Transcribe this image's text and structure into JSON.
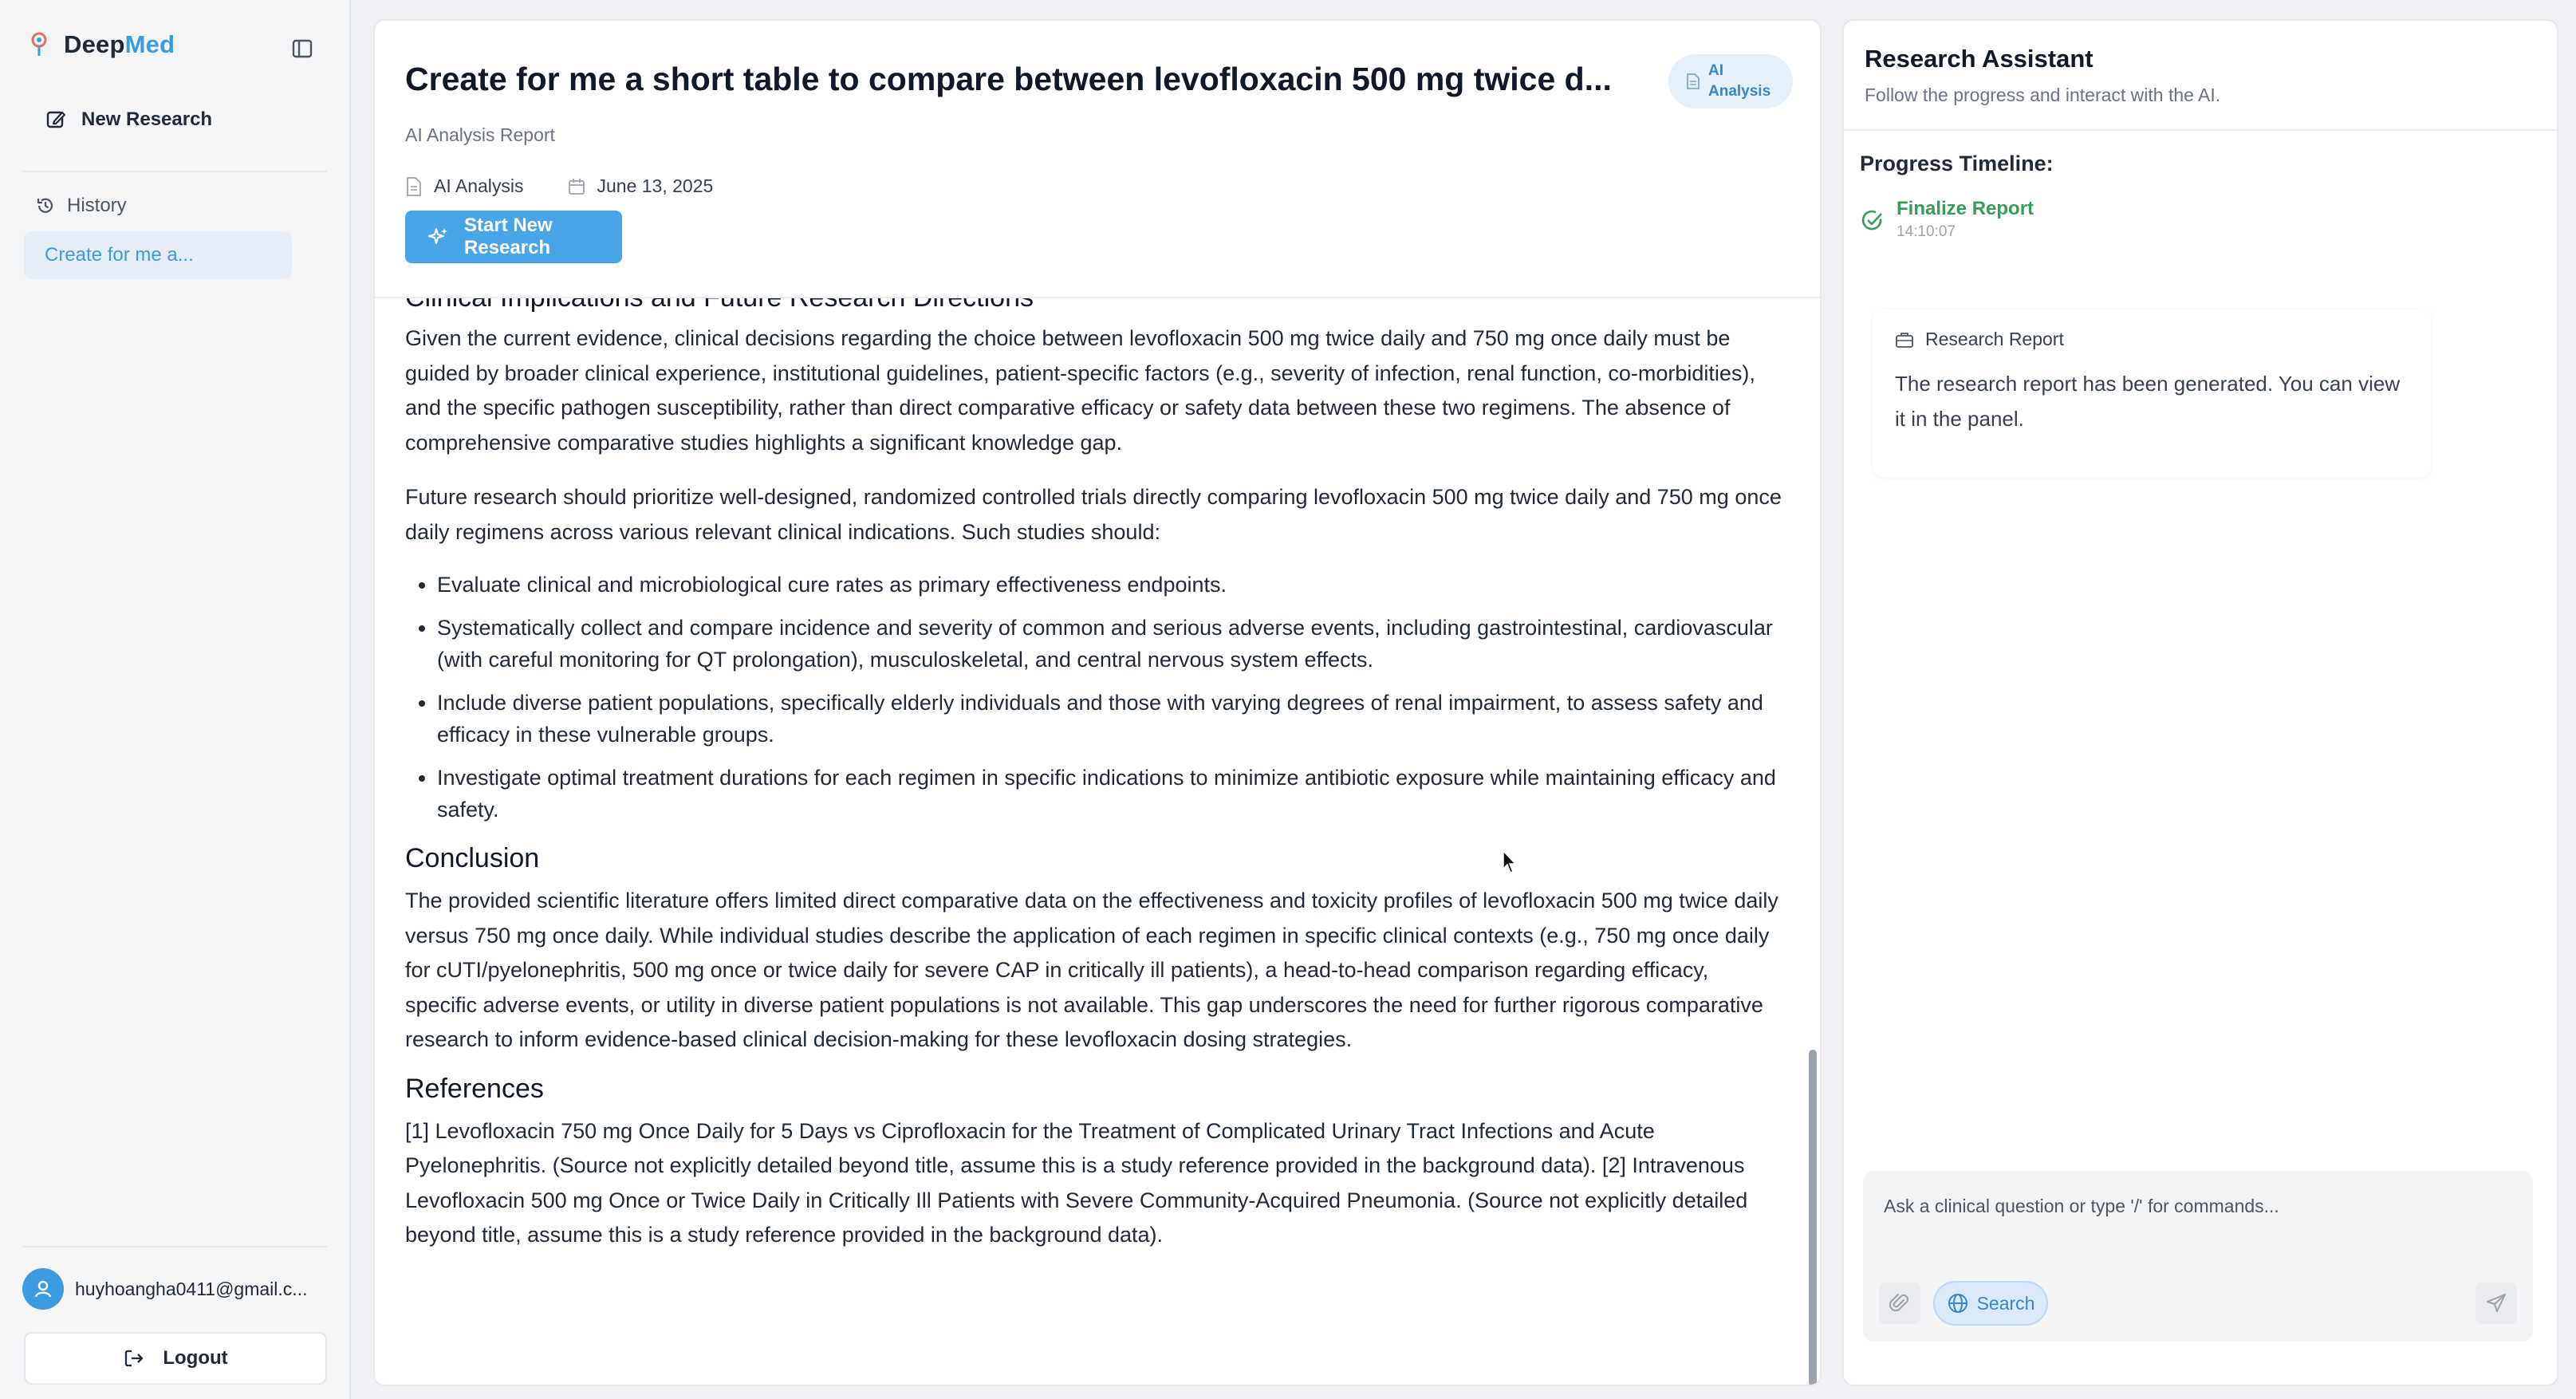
{
  "colors": {
    "accent": "#3b9be0",
    "button_blue": "#49a5e6",
    "success_green": "#3a9a57"
  },
  "sidebar": {
    "brand": {
      "name_dark": "Deep",
      "name_accent": "Med",
      "logo_icon": "logo-mark-icon"
    },
    "collapse_icon": "sidebar-toggle-icon",
    "new_research_label": "New Research",
    "history_label": "History",
    "history_items": [
      {
        "label": "Create for me a..."
      }
    ],
    "user_email": "huyhoangha0411@gmail.c...",
    "logout_label": "Logout"
  },
  "report": {
    "title": "Create for me a short table to compare between levofloxacin 500 mg twice d...",
    "badge_label": "AI Analysis",
    "subtitle": "AI Analysis Report",
    "meta_type": "AI Analysis",
    "meta_date": "June 13, 2025",
    "start_button_label": "Start New Research",
    "sections": {
      "implications": {
        "heading": "Clinical Implications and Future Research Directions",
        "p1": "Given the current evidence, clinical decisions regarding the choice between levofloxacin 500 mg twice daily and 750 mg once daily must be guided by broader clinical experience, institutional guidelines, patient-specific factors (e.g., severity of infection, renal function, co-morbidities), and the specific pathogen susceptibility, rather than direct comparative efficacy or safety data between these two regimens. The absence of comprehensive comparative studies highlights a significant knowledge gap.",
        "p2": "Future research should prioritize well-designed, randomized controlled trials directly comparing levofloxacin 500 mg twice daily and 750 mg once daily regimens across various relevant clinical indications. Such studies should:",
        "bullets": [
          "Evaluate clinical and microbiological cure rates as primary effectiveness endpoints.",
          "Systematically collect and compare incidence and severity of common and serious adverse events, including gastrointestinal, cardiovascular (with careful monitoring for QT prolongation), musculoskeletal, and central nervous system effects.",
          "Include diverse patient populations, specifically elderly individuals and those with varying degrees of renal impairment, to assess safety and efficacy in these vulnerable groups.",
          "Investigate optimal treatment durations for each regimen in specific indications to minimize antibiotic exposure while maintaining efficacy and safety."
        ]
      },
      "conclusion": {
        "heading": "Conclusion",
        "text": "The provided scientific literature offers limited direct comparative data on the effectiveness and toxicity profiles of levofloxacin 500 mg twice daily versus 750 mg once daily. While individual studies describe the application of each regimen in specific clinical contexts (e.g., 750 mg once daily for cUTI/pyelonephritis, 500 mg once or twice daily for severe CAP in critically ill patients), a head-to-head comparison regarding efficacy, specific adverse events, or utility in diverse patient populations is not available. This gap underscores the need for further rigorous comparative research to inform evidence-based clinical decision-making for these levofloxacin dosing strategies."
      },
      "references": {
        "heading": "References",
        "text": "[1] Levofloxacin 750 mg Once Daily for 5 Days vs Ciprofloxacin for the Treatment of Complicated Urinary Tract Infections and Acute Pyelonephritis. (Source not explicitly detailed beyond title, assume this is a study reference provided in the background data). [2] Intravenous Levofloxacin 500 mg Once or Twice Daily in Critically Ill Patients with Severe Community-Acquired Pneumonia. (Source not explicitly detailed beyond title, assume this is a study reference provided in the background data)."
      }
    }
  },
  "assistant": {
    "title": "Research Assistant",
    "subtitle": "Follow the progress and interact with the AI.",
    "timeline_label": "Progress Timeline:",
    "timeline": [
      {
        "title": "Finalize Report",
        "time": "14:10:07",
        "status": "complete"
      }
    ],
    "report_card": {
      "title": "Research Report",
      "text": "The research report has been generated. You can view it in the panel."
    },
    "chat": {
      "placeholder": "Ask a clinical question or type '/' for commands...",
      "value": "",
      "search_label": "Search"
    }
  }
}
